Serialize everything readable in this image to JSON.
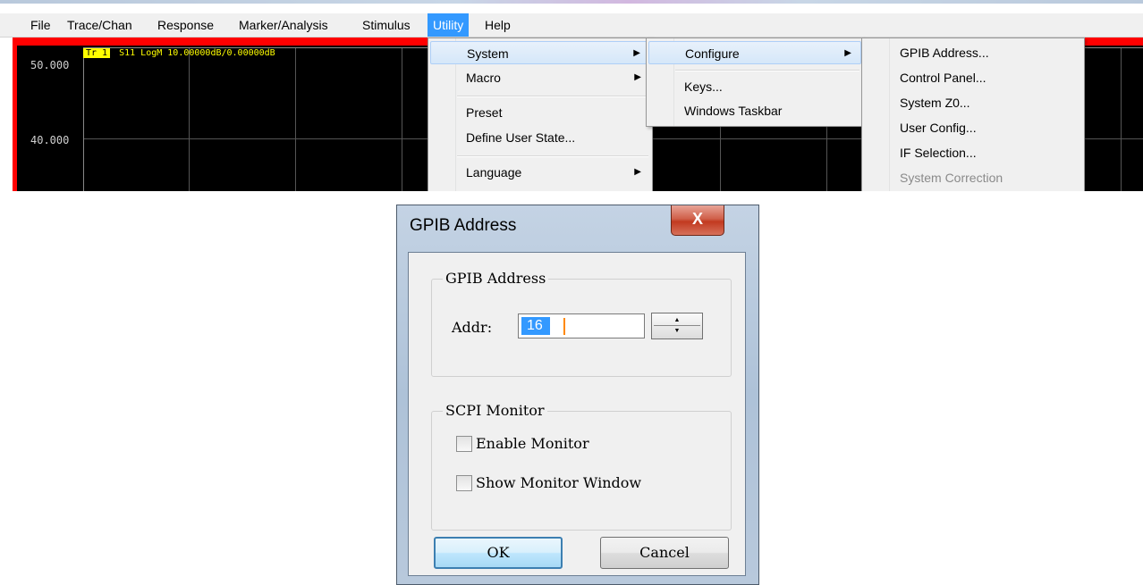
{
  "menubar": {
    "items": [
      "File",
      "Trace/Chan",
      "Response",
      "Marker/Analysis",
      "Stimulus",
      "Utility",
      "Help"
    ],
    "active": "Utility"
  },
  "chart": {
    "trace_label": "Tr 1",
    "trace_info": "S11 LogM 10.00000dB/0.00000dB",
    "y_ticks": [
      "50.000",
      "40.000"
    ],
    "colors": {
      "frame": "#ff0000",
      "background": "#000000",
      "trace_text": "#ffff00"
    }
  },
  "utility_menu": {
    "items": [
      {
        "label": "System",
        "submenu": true,
        "highlighted": true
      },
      {
        "label": "Macro",
        "submenu": true
      },
      {
        "label": "Preset"
      },
      {
        "label": "Define User State..."
      },
      {
        "label": "Language",
        "submenu": true
      }
    ]
  },
  "system_menu": {
    "items": [
      {
        "label": "Configure",
        "submenu": true,
        "highlighted": true
      },
      {
        "label": "Keys..."
      },
      {
        "label": "Windows Taskbar"
      }
    ]
  },
  "configure_menu": {
    "items": [
      {
        "label": "GPIB Address..."
      },
      {
        "label": "Control Panel..."
      },
      {
        "label": "System Z0..."
      },
      {
        "label": "User Config..."
      },
      {
        "label": "IF Selection..."
      },
      {
        "label": "System Correction",
        "disabled": true
      }
    ]
  },
  "dialog": {
    "title": "GPIB Address",
    "close_glyph": "X",
    "gpib_group": {
      "title": "GPIB Address",
      "addr_label": "Addr:",
      "addr_value": "16"
    },
    "scpi_group": {
      "title": "SCPI Monitor",
      "enable_monitor": {
        "label": "Enable Monitor",
        "checked": false
      },
      "show_window": {
        "label": "Show Monitor Window",
        "checked": false
      }
    },
    "ok_label": "OK",
    "cancel_label": "Cancel"
  }
}
